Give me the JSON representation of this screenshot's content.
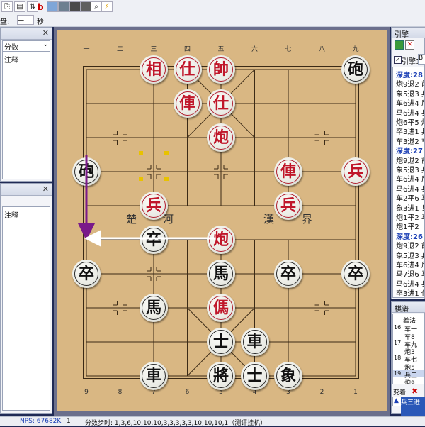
{
  "toolbar": {
    "bold_b": "b",
    "board_label": "盘:",
    "dash": "一",
    "sec": "秒",
    "icons": [
      "copy-icon",
      "paste-icon",
      "flip-icon",
      "board-icon",
      "image-icon",
      "stop-icon",
      "search-icon",
      "bolt-icon"
    ]
  },
  "left_panel_1": {
    "dropdown": "分数",
    "header": "注释"
  },
  "left_panel_2": {
    "header": "注释"
  },
  "board": {
    "top_numbers": [
      "一",
      "二",
      "三",
      "四",
      "五",
      "六",
      "七",
      "八",
      "九"
    ],
    "bottom_numbers": [
      "9",
      "8",
      "7",
      "6",
      "5",
      "4",
      "3",
      "2",
      "1"
    ],
    "river_left_1": "楚",
    "river_left_2": "河",
    "river_right_1": "漢",
    "river_right_2": "界",
    "pieces": [
      {
        "ch": "相",
        "side": "red",
        "file": 3,
        "rank": 1
      },
      {
        "ch": "仕",
        "side": "red",
        "file": 4,
        "rank": 1
      },
      {
        "ch": "帥",
        "side": "red",
        "file": 5,
        "rank": 1
      },
      {
        "ch": "砲",
        "side": "black",
        "file": 9,
        "rank": 1
      },
      {
        "ch": "俥",
        "side": "red",
        "file": 4,
        "rank": 2
      },
      {
        "ch": "仕",
        "side": "red",
        "file": 5,
        "rank": 2
      },
      {
        "ch": "炮",
        "side": "red",
        "file": 5,
        "rank": 3
      },
      {
        "ch": "砲",
        "side": "black",
        "file": 1,
        "rank": 4
      },
      {
        "ch": "俥",
        "side": "red",
        "file": 7,
        "rank": 4
      },
      {
        "ch": "兵",
        "side": "red",
        "file": 9,
        "rank": 4
      },
      {
        "ch": "兵",
        "side": "red",
        "file": 3,
        "rank": 5
      },
      {
        "ch": "兵",
        "side": "red",
        "file": 7,
        "rank": 5
      },
      {
        "ch": "卒",
        "side": "black",
        "file": 3,
        "rank": 6
      },
      {
        "ch": "炮",
        "side": "red",
        "file": 5,
        "rank": 6
      },
      {
        "ch": "卒",
        "side": "black",
        "file": 1,
        "rank": 7
      },
      {
        "ch": "馬",
        "side": "black",
        "file": 5,
        "rank": 7
      },
      {
        "ch": "卒",
        "side": "black",
        "file": 7,
        "rank": 7
      },
      {
        "ch": "卒",
        "side": "black",
        "file": 9,
        "rank": 7
      },
      {
        "ch": "馬",
        "side": "black",
        "file": 3,
        "rank": 8
      },
      {
        "ch": "傌",
        "side": "red",
        "file": 5,
        "rank": 8
      },
      {
        "ch": "士",
        "side": "black",
        "file": 5,
        "rank": 9
      },
      {
        "ch": "車",
        "side": "black",
        "file": 6,
        "rank": 9
      },
      {
        "ch": "車",
        "side": "black",
        "file": 3,
        "rank": 10
      },
      {
        "ch": "將",
        "side": "black",
        "file": 5,
        "rank": 10
      },
      {
        "ch": "士",
        "side": "black",
        "file": 6,
        "rank": 10
      },
      {
        "ch": "象",
        "side": "black",
        "file": 7,
        "rank": 10
      }
    ]
  },
  "engine_panel": {
    "title": "引擎",
    "engine_label": "引擎1:",
    "engine_value": "B",
    "lines": [
      {
        "text": "深度:28  己",
        "depth": true
      },
      {
        "text": "炮9退2 前"
      },
      {
        "text": "象5退3 兵"
      },
      {
        "text": "车6进4 后"
      },
      {
        "text": "马6进4 兵"
      },
      {
        "text": "炮6平5 炮"
      },
      {
        "text": "卒3进1 兵"
      },
      {
        "text": "车3退2 车"
      },
      {
        "text": "深度:27  己",
        "depth": true
      },
      {
        "text": "炮9退2 前"
      },
      {
        "text": "象5退3 兵"
      },
      {
        "text": "车6进4 后"
      },
      {
        "text": "马6进4 兵"
      },
      {
        "text": "车2平6 马"
      },
      {
        "text": "象3进1 兵"
      },
      {
        "text": "炮1平2 马"
      },
      {
        "text": "炮1平2"
      },
      {
        "text": "深度:26  己",
        "depth": true
      },
      {
        "text": "炮9退2 前"
      },
      {
        "text": "象5退3 兵"
      },
      {
        "text": "车6进4 后"
      },
      {
        "text": "马7退6 马"
      },
      {
        "text": "马6进4 兵"
      },
      {
        "text": "卒3进1 仕"
      }
    ]
  },
  "moves_panel": {
    "title": "棋谱",
    "col_header": "着法",
    "rows": [
      {
        "num": "16",
        "move": "车一"
      },
      {
        "num": "",
        "move": "车8"
      },
      {
        "num": "17",
        "move": "车九"
      },
      {
        "num": "",
        "move": "炮3"
      },
      {
        "num": "18",
        "move": "车七"
      },
      {
        "num": "",
        "move": "炮5"
      },
      {
        "num": "19",
        "move": "兵三"
      },
      {
        "num": "",
        "move": "炮9"
      }
    ],
    "bottom_label": "变着:",
    "bottom_move": "兵三进一"
  },
  "status": {
    "nps": "NPS: 67682K",
    "page": "1",
    "steps": "分数步时: 1,3,6,10,10,10,3,3,3,3,3,10,10,10,1（测评挂机）"
  }
}
